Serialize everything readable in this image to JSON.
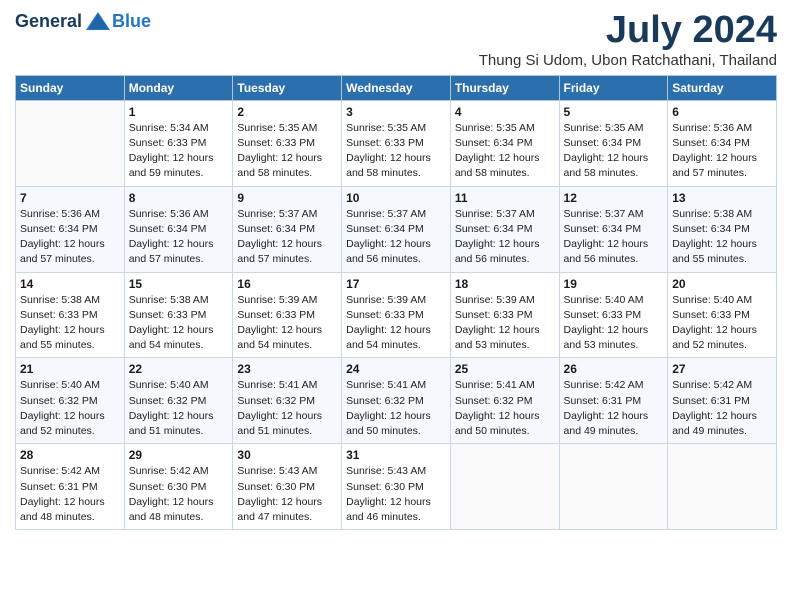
{
  "header": {
    "logo_general": "General",
    "logo_blue": "Blue",
    "month_title": "July 2024",
    "location": "Thung Si Udom, Ubon Ratchathani, Thailand"
  },
  "days_of_week": [
    "Sunday",
    "Monday",
    "Tuesday",
    "Wednesday",
    "Thursday",
    "Friday",
    "Saturday"
  ],
  "weeks": [
    [
      {
        "day": "",
        "info": ""
      },
      {
        "day": "1",
        "info": "Sunrise: 5:34 AM\nSunset: 6:33 PM\nDaylight: 12 hours\nand 59 minutes."
      },
      {
        "day": "2",
        "info": "Sunrise: 5:35 AM\nSunset: 6:33 PM\nDaylight: 12 hours\nand 58 minutes."
      },
      {
        "day": "3",
        "info": "Sunrise: 5:35 AM\nSunset: 6:33 PM\nDaylight: 12 hours\nand 58 minutes."
      },
      {
        "day": "4",
        "info": "Sunrise: 5:35 AM\nSunset: 6:34 PM\nDaylight: 12 hours\nand 58 minutes."
      },
      {
        "day": "5",
        "info": "Sunrise: 5:35 AM\nSunset: 6:34 PM\nDaylight: 12 hours\nand 58 minutes."
      },
      {
        "day": "6",
        "info": "Sunrise: 5:36 AM\nSunset: 6:34 PM\nDaylight: 12 hours\nand 57 minutes."
      }
    ],
    [
      {
        "day": "7",
        "info": "Sunrise: 5:36 AM\nSunset: 6:34 PM\nDaylight: 12 hours\nand 57 minutes."
      },
      {
        "day": "8",
        "info": "Sunrise: 5:36 AM\nSunset: 6:34 PM\nDaylight: 12 hours\nand 57 minutes."
      },
      {
        "day": "9",
        "info": "Sunrise: 5:37 AM\nSunset: 6:34 PM\nDaylight: 12 hours\nand 57 minutes."
      },
      {
        "day": "10",
        "info": "Sunrise: 5:37 AM\nSunset: 6:34 PM\nDaylight: 12 hours\nand 56 minutes."
      },
      {
        "day": "11",
        "info": "Sunrise: 5:37 AM\nSunset: 6:34 PM\nDaylight: 12 hours\nand 56 minutes."
      },
      {
        "day": "12",
        "info": "Sunrise: 5:37 AM\nSunset: 6:34 PM\nDaylight: 12 hours\nand 56 minutes."
      },
      {
        "day": "13",
        "info": "Sunrise: 5:38 AM\nSunset: 6:34 PM\nDaylight: 12 hours\nand 55 minutes."
      }
    ],
    [
      {
        "day": "14",
        "info": "Sunrise: 5:38 AM\nSunset: 6:33 PM\nDaylight: 12 hours\nand 55 minutes."
      },
      {
        "day": "15",
        "info": "Sunrise: 5:38 AM\nSunset: 6:33 PM\nDaylight: 12 hours\nand 54 minutes."
      },
      {
        "day": "16",
        "info": "Sunrise: 5:39 AM\nSunset: 6:33 PM\nDaylight: 12 hours\nand 54 minutes."
      },
      {
        "day": "17",
        "info": "Sunrise: 5:39 AM\nSunset: 6:33 PM\nDaylight: 12 hours\nand 54 minutes."
      },
      {
        "day": "18",
        "info": "Sunrise: 5:39 AM\nSunset: 6:33 PM\nDaylight: 12 hours\nand 53 minutes."
      },
      {
        "day": "19",
        "info": "Sunrise: 5:40 AM\nSunset: 6:33 PM\nDaylight: 12 hours\nand 53 minutes."
      },
      {
        "day": "20",
        "info": "Sunrise: 5:40 AM\nSunset: 6:33 PM\nDaylight: 12 hours\nand 52 minutes."
      }
    ],
    [
      {
        "day": "21",
        "info": "Sunrise: 5:40 AM\nSunset: 6:32 PM\nDaylight: 12 hours\nand 52 minutes."
      },
      {
        "day": "22",
        "info": "Sunrise: 5:40 AM\nSunset: 6:32 PM\nDaylight: 12 hours\nand 51 minutes."
      },
      {
        "day": "23",
        "info": "Sunrise: 5:41 AM\nSunset: 6:32 PM\nDaylight: 12 hours\nand 51 minutes."
      },
      {
        "day": "24",
        "info": "Sunrise: 5:41 AM\nSunset: 6:32 PM\nDaylight: 12 hours\nand 50 minutes."
      },
      {
        "day": "25",
        "info": "Sunrise: 5:41 AM\nSunset: 6:32 PM\nDaylight: 12 hours\nand 50 minutes."
      },
      {
        "day": "26",
        "info": "Sunrise: 5:42 AM\nSunset: 6:31 PM\nDaylight: 12 hours\nand 49 minutes."
      },
      {
        "day": "27",
        "info": "Sunrise: 5:42 AM\nSunset: 6:31 PM\nDaylight: 12 hours\nand 49 minutes."
      }
    ],
    [
      {
        "day": "28",
        "info": "Sunrise: 5:42 AM\nSunset: 6:31 PM\nDaylight: 12 hours\nand 48 minutes."
      },
      {
        "day": "29",
        "info": "Sunrise: 5:42 AM\nSunset: 6:30 PM\nDaylight: 12 hours\nand 48 minutes."
      },
      {
        "day": "30",
        "info": "Sunrise: 5:43 AM\nSunset: 6:30 PM\nDaylight: 12 hours\nand 47 minutes."
      },
      {
        "day": "31",
        "info": "Sunrise: 5:43 AM\nSunset: 6:30 PM\nDaylight: 12 hours\nand 46 minutes."
      },
      {
        "day": "",
        "info": ""
      },
      {
        "day": "",
        "info": ""
      },
      {
        "day": "",
        "info": ""
      }
    ]
  ]
}
